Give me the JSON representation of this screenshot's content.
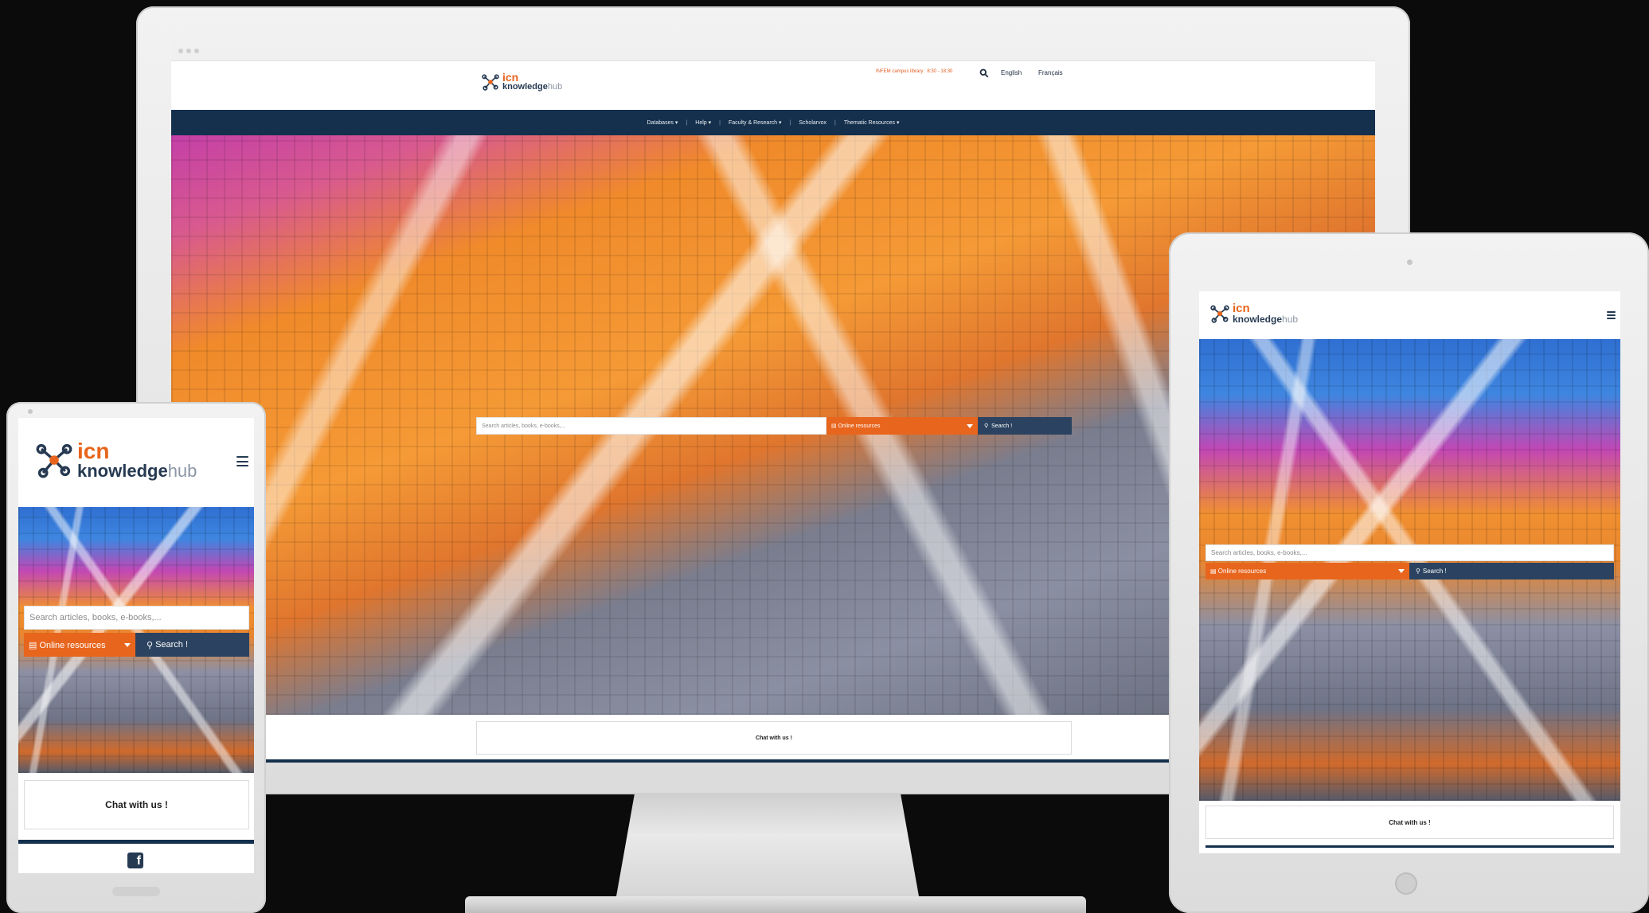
{
  "brand": {
    "name_part1": "icn",
    "name_part2": "knowledge",
    "name_part3": "hub",
    "accent_color": "#e8651d",
    "navy_color": "#14304d",
    "button_color": "#2b4360"
  },
  "desktop": {
    "top_notice": "INFEM campus library : 8:30 - 18:30",
    "languages": [
      "English",
      "Français"
    ],
    "nav": [
      {
        "label": "Databases",
        "dropdown": true
      },
      {
        "label": "Help",
        "dropdown": true
      },
      {
        "label": "Faculty & Research",
        "dropdown": true
      },
      {
        "label": "Scholarvox",
        "dropdown": false
      },
      {
        "label": "Thematic Resources",
        "dropdown": true
      }
    ],
    "search": {
      "placeholder": "Search articles, books, e-books,...",
      "select_value": "Online resources",
      "button_label": "Search !"
    },
    "chat_label": "Chat with us !"
  },
  "tablet": {
    "search": {
      "placeholder": "Search articles, books, e-books,...",
      "select_value": "Online resources",
      "button_label": "Search !"
    },
    "chat_label": "Chat with us !"
  },
  "phone": {
    "search": {
      "placeholder": "Search articles, books, e-books,...",
      "select_value": "Online resources",
      "button_label": "Search !"
    },
    "chat_label": "Chat with us !",
    "footer_icon": "facebook-icon"
  }
}
